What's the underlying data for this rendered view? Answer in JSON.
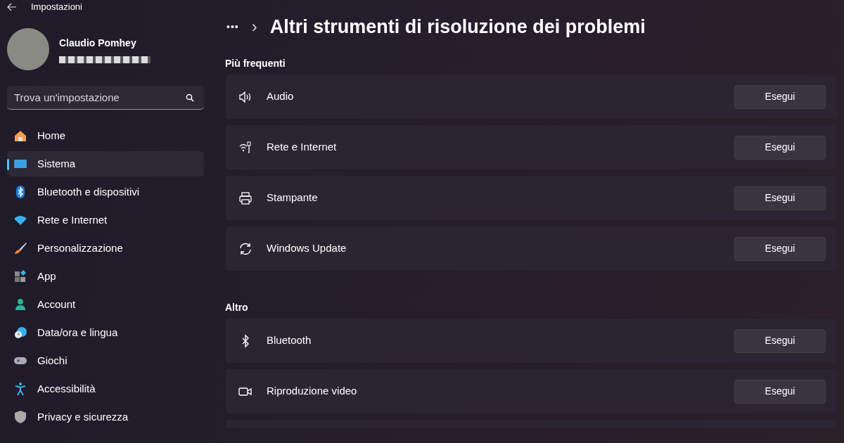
{
  "window": {
    "title": "Impostazioni"
  },
  "profile": {
    "name": "Claudio Pomhey"
  },
  "search": {
    "placeholder": "Trova un'impostazione"
  },
  "sidebar": {
    "items": [
      {
        "label": "Home",
        "selected": false
      },
      {
        "label": "Sistema",
        "selected": true
      },
      {
        "label": "Bluetooth e dispositivi",
        "selected": false
      },
      {
        "label": "Rete e Internet",
        "selected": false
      },
      {
        "label": "Personalizzazione",
        "selected": false
      },
      {
        "label": "App",
        "selected": false
      },
      {
        "label": "Account",
        "selected": false
      },
      {
        "label": "Data/ora e lingua",
        "selected": false
      },
      {
        "label": "Giochi",
        "selected": false
      },
      {
        "label": "Accessibilità",
        "selected": false
      },
      {
        "label": "Privacy e sicurezza",
        "selected": false
      }
    ]
  },
  "breadcrumb": {
    "overflow": "•••",
    "separator": "›",
    "title": "Altri strumenti di risoluzione dei problemi"
  },
  "sections": [
    {
      "heading": "Più frequenti",
      "rows": [
        {
          "label": "Audio",
          "button": "Esegui"
        },
        {
          "label": "Rete e Internet",
          "button": "Esegui"
        },
        {
          "label": "Stampante",
          "button": "Esegui"
        },
        {
          "label": "Windows Update",
          "button": "Esegui"
        }
      ]
    },
    {
      "heading": "Altro",
      "rows": [
        {
          "label": "Bluetooth",
          "button": "Esegui"
        },
        {
          "label": "Riproduzione video",
          "button": "Esegui"
        }
      ]
    }
  ]
}
